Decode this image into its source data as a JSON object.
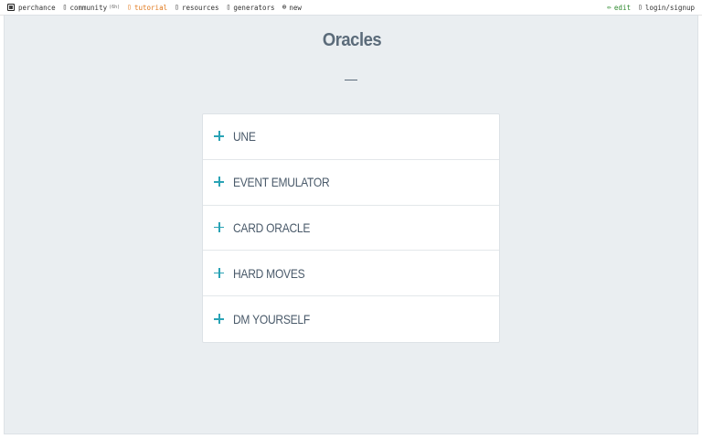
{
  "topbar": {
    "left": [
      {
        "label": "perchance",
        "icon": "dice-icon"
      },
      {
        "label": "community",
        "sub": "(6h)",
        "icon": "chat-icon"
      },
      {
        "label": "tutorial",
        "icon": "book-icon"
      },
      {
        "label": "resources",
        "icon": "info-icon"
      },
      {
        "label": "generators",
        "icon": "list-icon"
      },
      {
        "label": "new",
        "icon": "plus-circle-icon",
        "glyph": "⊕"
      }
    ],
    "right": [
      {
        "label": "edit",
        "icon": "pencil-icon",
        "glyph": "✏"
      },
      {
        "label": "login/signup",
        "icon": "user-icon"
      }
    ]
  },
  "page": {
    "title": "Oracles"
  },
  "accordion": {
    "items": [
      {
        "label": "UNE"
      },
      {
        "label": "EVENT EMULATOR"
      },
      {
        "label": "CARD ORACLE"
      },
      {
        "label": "HARD MOVES"
      },
      {
        "label": "DM YOURSELF"
      }
    ]
  },
  "colors": {
    "accent": "#2aa3b5",
    "title": "#5b6b7a",
    "tutorial": "#e0781c",
    "edit": "#2f8a2f",
    "background": "#eaeef1"
  }
}
